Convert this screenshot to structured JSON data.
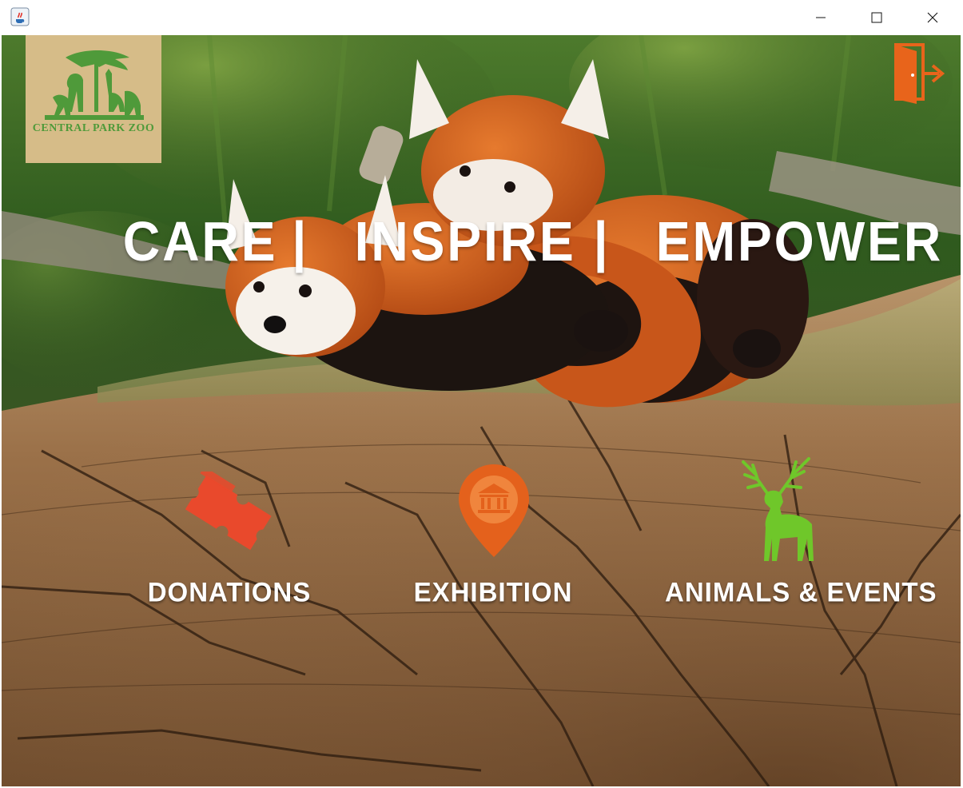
{
  "window": {
    "title": "",
    "app_icon": "java-cup-icon",
    "controls": [
      "minimize-icon",
      "maximize-icon",
      "close-icon"
    ]
  },
  "logo": {
    "icon": "zoo-logo-icon",
    "text": "CENTRAL PARK ZOO"
  },
  "header": {
    "exit_icon": "exit-door-icon",
    "exit_color": "#e8641b"
  },
  "slogan": {
    "word1": "CARE",
    "sep1": "|",
    "word2": "INSPIRE",
    "sep2": "|",
    "word3": "EMPOWER"
  },
  "menu": [
    {
      "label": "DONATIONS",
      "icon": "ticket-icon",
      "color": "#e9492c"
    },
    {
      "label": "EXHIBITION",
      "icon": "museum-location-pin-icon",
      "color": "#e4611c"
    },
    {
      "label": "ANIMALS & EVENTS",
      "icon": "deer-icon",
      "color": "#6fc72a"
    }
  ]
}
